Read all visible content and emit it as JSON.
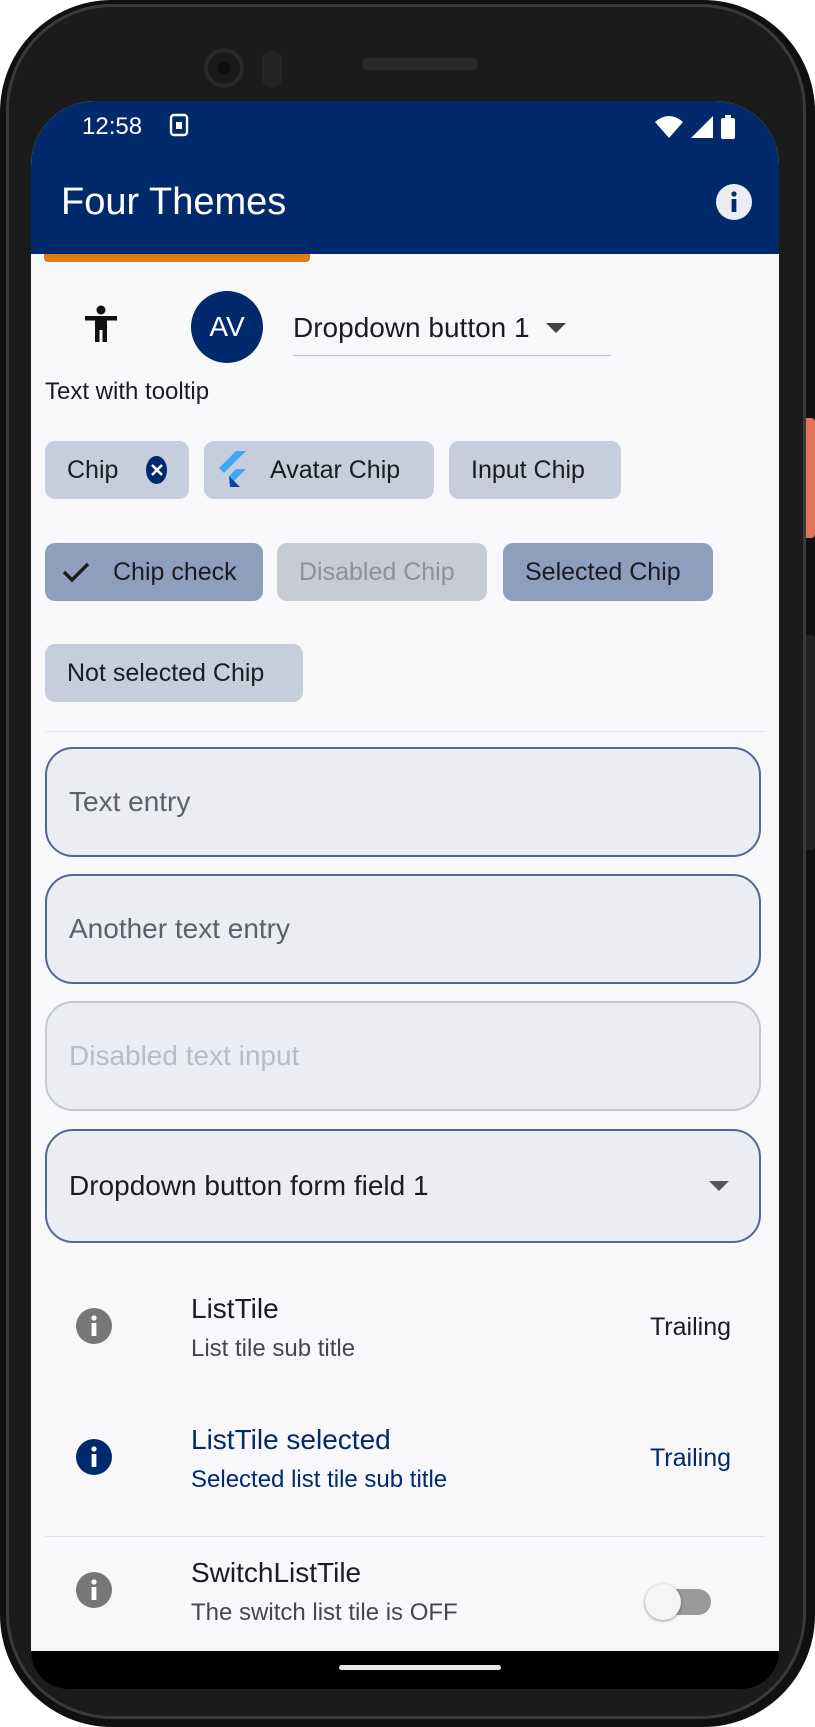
{
  "status_bar": {
    "time": "12:58"
  },
  "app_bar": {
    "title": "Four Themes"
  },
  "avatar": {
    "initials": "AV"
  },
  "dropdown_button": {
    "label": "Dropdown button 1"
  },
  "tooltip_text": "Text with tooltip",
  "chips_row1": [
    {
      "label": "Chip"
    },
    {
      "label": "Avatar Chip"
    },
    {
      "label": "Input Chip"
    }
  ],
  "chips_row2": [
    {
      "label": "Chip check"
    },
    {
      "label": "Disabled Chip"
    },
    {
      "label": "Selected Chip"
    }
  ],
  "chips_row3": [
    {
      "label": "Not selected Chip"
    }
  ],
  "fields": {
    "text_entry_placeholder": "Text entry",
    "another_placeholder": "Another text entry",
    "disabled_placeholder": "Disabled text input",
    "dropdown_value": "Dropdown button form field 1"
  },
  "list_tiles": [
    {
      "title": "ListTile",
      "subtitle": "List tile sub title",
      "trailing": "Trailing"
    },
    {
      "title": "ListTile selected",
      "subtitle": "Selected list tile sub title",
      "trailing": "Trailing"
    },
    {
      "title": "SwitchListTile",
      "subtitle": "The switch list tile is OFF"
    }
  ],
  "colors": {
    "primary": "#002a6b",
    "accent_orange": "#e07b14",
    "chip": "#c6cedd",
    "chip_selected": "#8d9fbc"
  }
}
